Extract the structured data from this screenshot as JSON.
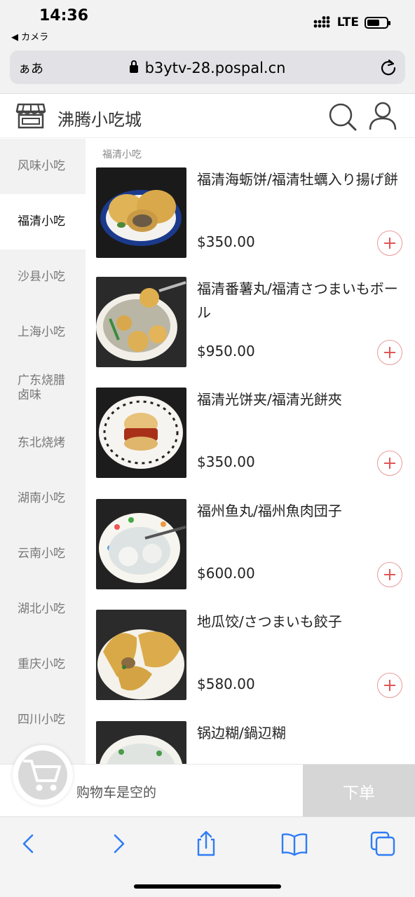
{
  "status_bar": {
    "time": "14:36",
    "back_app": "◀ カメラ",
    "network": "LTE"
  },
  "browser": {
    "aa_label": "ぁあ",
    "url": "b3ytv-28.pospal.cn"
  },
  "header": {
    "title": "沸腾小吃城"
  },
  "sidebar": {
    "items": [
      {
        "label": "风味小吃",
        "active": false
      },
      {
        "label": "福清小吃",
        "active": true
      },
      {
        "label": "沙县小吃",
        "active": false
      },
      {
        "label": "上海小吃",
        "active": false
      },
      {
        "label": "广东烧腊卤味",
        "active": false
      },
      {
        "label": "东北烧烤",
        "active": false
      },
      {
        "label": "湖南小吃",
        "active": false
      },
      {
        "label": "云南小吃",
        "active": false
      },
      {
        "label": "湖北小吃",
        "active": false
      },
      {
        "label": "重庆小吃",
        "active": false
      },
      {
        "label": "四川小吃",
        "active": false
      }
    ]
  },
  "section": {
    "title": "福清小吃"
  },
  "products": [
    {
      "name": "福清海蛎饼/福清牡蠣入り揚げ餅",
      "price": "$350.00"
    },
    {
      "name": "福清番薯丸/福清さつまいもボール",
      "price": "$950.00"
    },
    {
      "name": "福清光饼夹/福清光餅夾",
      "price": "$350.00"
    },
    {
      "name": "福州鱼丸/福州魚肉団子",
      "price": "$600.00"
    },
    {
      "name": "地瓜饺/さつまいも餃子",
      "price": "$580.00"
    },
    {
      "name": "锅边糊/鍋辺糊",
      "price": ""
    }
  ],
  "cart": {
    "empty_text": "购物车是空的",
    "order_label": "下单"
  },
  "colors": {
    "accent": "#e05555",
    "sidebar_bg": "#f2f2f2",
    "ios_blue": "#2f7cf6"
  }
}
